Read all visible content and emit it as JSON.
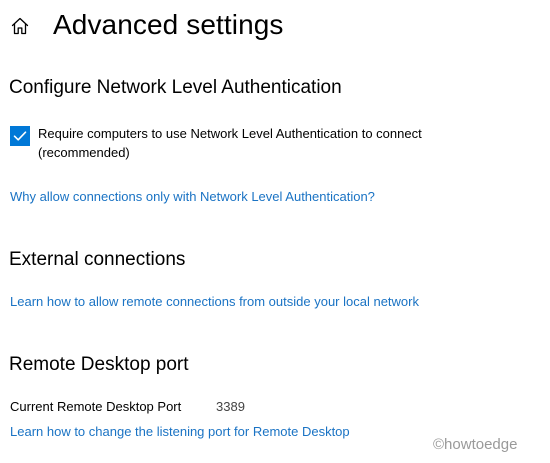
{
  "header": {
    "title": "Advanced settings",
    "home_icon": "home-icon"
  },
  "nla": {
    "heading": "Configure Network Level Authentication",
    "checkbox_label": "Require computers to use Network Level Authentication to connect (recommended)",
    "checked": true,
    "link": "Why allow connections only with Network Level Authentication?"
  },
  "external": {
    "heading": "External connections",
    "link": "Learn how to allow remote connections from outside your local network"
  },
  "port": {
    "heading": "Remote Desktop port",
    "label": "Current Remote Desktop Port",
    "value": "3389",
    "link": "Learn how to change the listening port for Remote Desktop"
  },
  "watermark": "©howtoedge",
  "colors": {
    "accent": "#0078d7",
    "link": "#1a73c4"
  }
}
